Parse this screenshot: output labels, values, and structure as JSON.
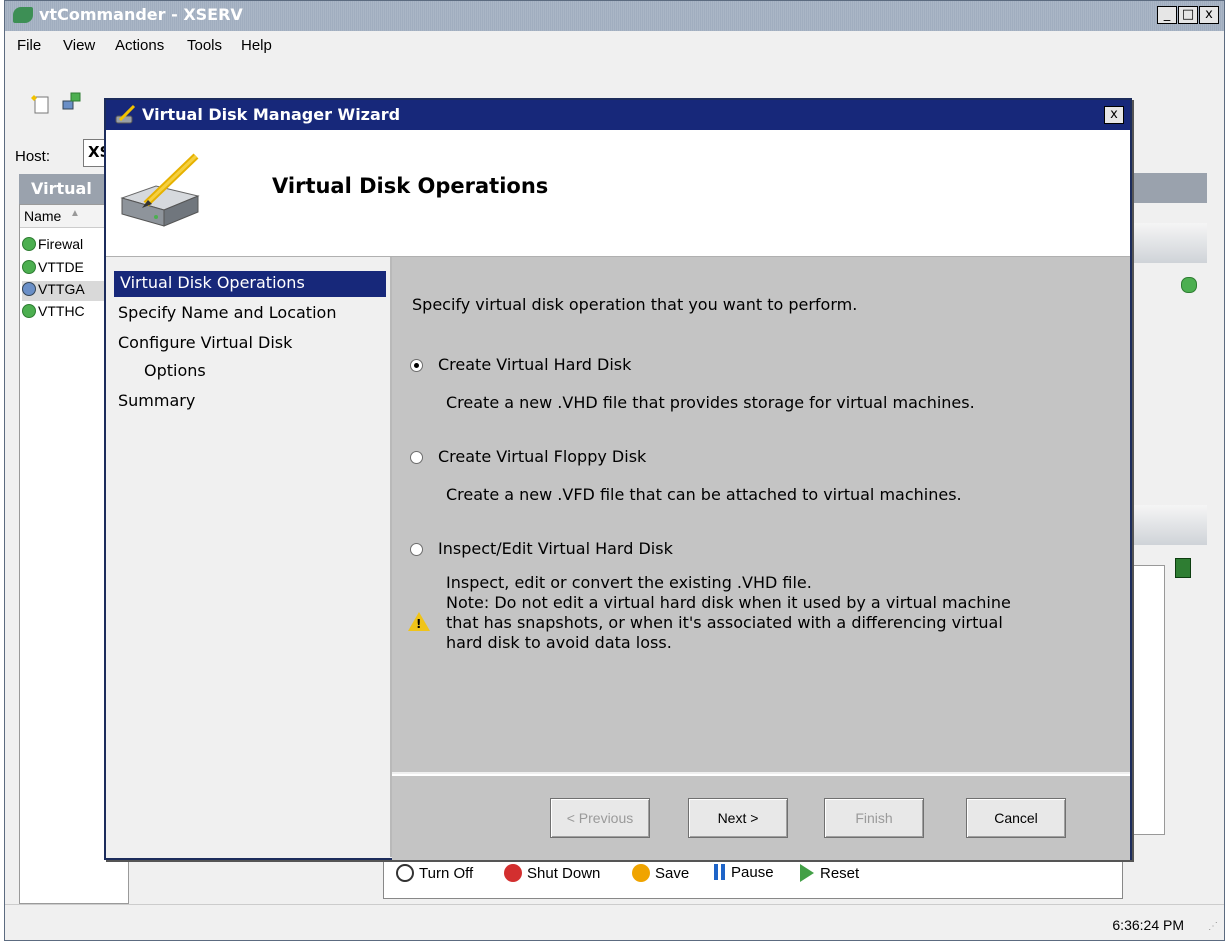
{
  "app": {
    "title": "vtCommander - XSERV",
    "window_buttons": {
      "minimize": "_",
      "maximize": "□",
      "close": "x"
    },
    "menu": [
      "File",
      "View",
      "Actions",
      "Tools",
      "Help"
    ],
    "host_label": "Host:",
    "host_value": "XS",
    "vm_panel_header": "Virtual",
    "vm_list_column": "Name",
    "vm_list": [
      "Firewal",
      "VTTDE",
      "VTTGA",
      "VTTHC"
    ],
    "bottom_actions": [
      "Turn Off",
      "Shut Down",
      "Save",
      "Pause",
      "Reset"
    ],
    "clock": "6:36:24 PM"
  },
  "dialog": {
    "title": "Virtual Disk Manager Wizard",
    "close_label": "x",
    "header_title": "Virtual Disk Operations",
    "steps": [
      "Virtual Disk Operations",
      "Specify Name and Location",
      "Configure Virtual Disk",
      "Options",
      "Summary"
    ],
    "active_step": 0,
    "instruction": "Specify virtual disk operation that you want to perform.",
    "options": [
      {
        "label": "Create Virtual Hard Disk",
        "desc": "Create a new .VHD file that provides storage for virtual machines.",
        "selected": true
      },
      {
        "label": "Create Virtual Floppy Disk",
        "desc": "Create a new .VFD file that can be attached to virtual machines.",
        "selected": false
      },
      {
        "label": "Inspect/Edit Virtual Hard Disk",
        "desc": "Inspect, edit or convert the existing .VHD file.",
        "selected": false
      }
    ],
    "note_lines": [
      "Note: Do not edit a virtual hard disk when it used by a virtual machine",
      "that has snapshots, or when it's associated with a differencing virtual",
      "hard disk to avoid data loss."
    ],
    "buttons": {
      "previous": "< Previous",
      "next": "Next >",
      "finish": "Finish",
      "cancel": "Cancel"
    }
  },
  "colors": {
    "title_bar": "#17287a",
    "content_bg": "#c4c4c4",
    "warning": "#f0c419"
  }
}
